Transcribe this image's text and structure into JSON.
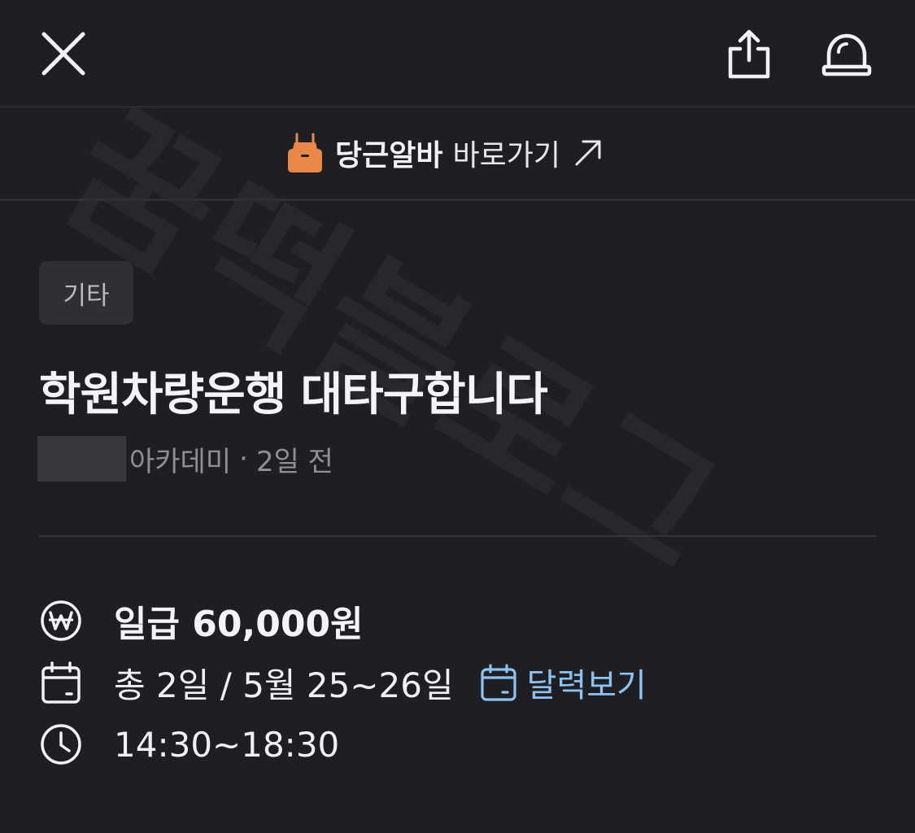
{
  "watermark_text": "꿈떡블로그",
  "topbar": {
    "close_icon": "close-icon",
    "share_icon": "share-icon",
    "alert_icon": "siren-icon"
  },
  "shortcut": {
    "icon": "apron-icon",
    "brand": "당근알바",
    "label": "바로가기",
    "arrow_icon": "arrow-up-right-icon",
    "brand_color": "#e8894a"
  },
  "post": {
    "category": "기타",
    "title": "학원차량운행 대타구합니다",
    "author": "아카데미",
    "separator": "·",
    "posted_ago": "2일 전"
  },
  "details": {
    "wage": {
      "icon": "won-icon",
      "text": "일급 60,000원"
    },
    "date": {
      "icon": "calendar-icon",
      "text": "총 2일 / 5월 25~26일",
      "link_icon": "calendar-icon",
      "link_label": "달력보기"
    },
    "time": {
      "icon": "clock-icon",
      "text": "14:30~18:30"
    }
  },
  "colors": {
    "background": "#1f1f23",
    "link": "#8cc3f2",
    "badge": "#2e3036"
  }
}
